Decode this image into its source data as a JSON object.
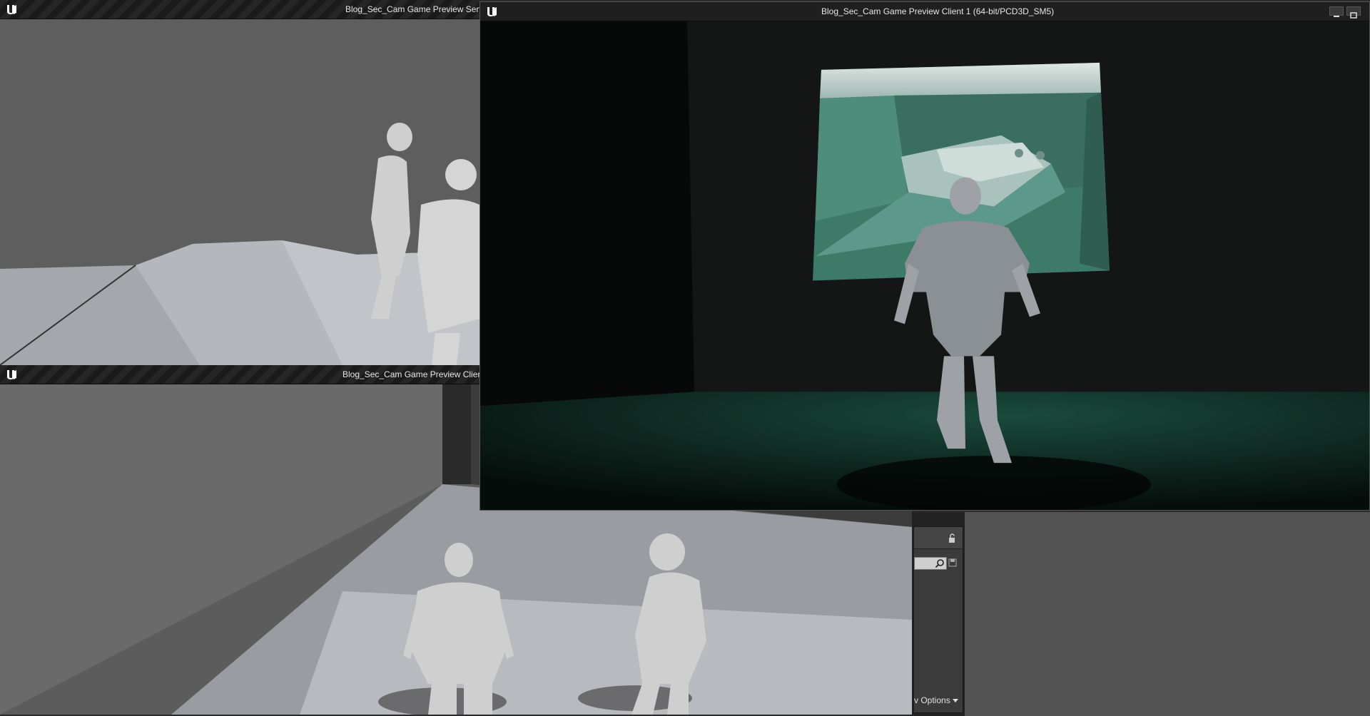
{
  "windows": {
    "server": {
      "title": "Blog_Sec_Cam Game Preview Serve"
    },
    "client2": {
      "title": "Blog_Sec_Cam Game Preview Client"
    },
    "client1": {
      "title": "Blog_Sec_Cam Game Preview Client 1 (64-bit/PCD3D_SM5)"
    }
  },
  "side_panel": {
    "options_label": "v Options"
  },
  "icons": [
    "unreal-logo-icon",
    "lock-icon",
    "search-icon",
    "save-icon",
    "minimize-icon",
    "maximize-icon",
    "dropdown-arrow-icon"
  ],
  "colors": {
    "titlebar": "#262626",
    "security_screen": "#3d7a68",
    "floor_green": "#0f2a22"
  }
}
